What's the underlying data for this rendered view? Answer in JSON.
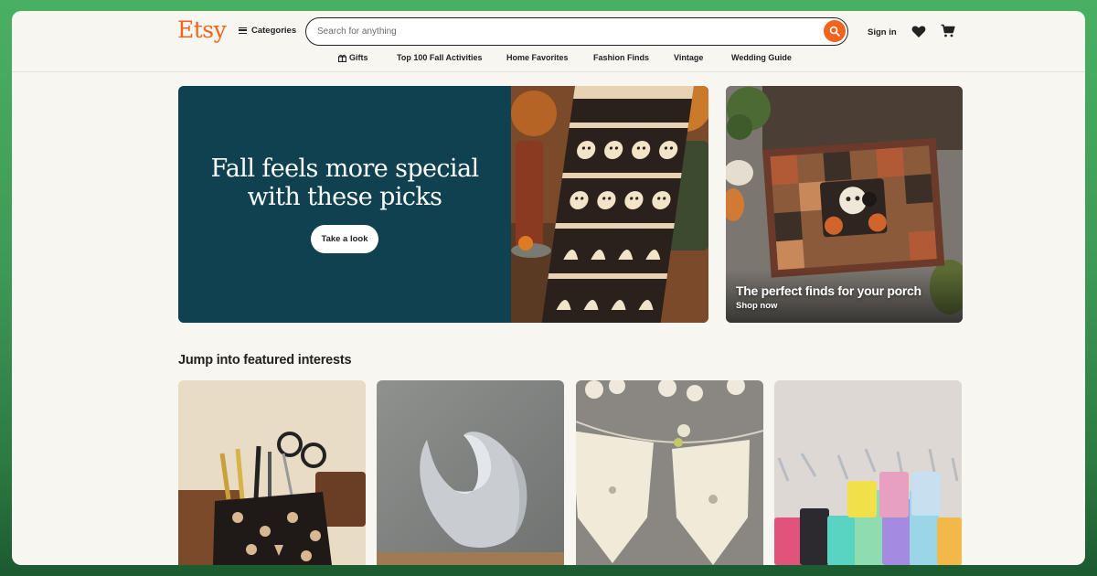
{
  "header": {
    "logo": "Etsy",
    "categories_label": "Categories",
    "search_placeholder": "Search for anything",
    "signin_label": "Sign in"
  },
  "nav": {
    "items": [
      "Gifts",
      "Top 100 Fall Activities",
      "Home Favorites",
      "Fashion Finds",
      "Vintage",
      "Wedding Guide"
    ]
  },
  "hero": {
    "title_line1": "Fall feels more special",
    "title_line2": "with these picks",
    "button_label": "Take a look",
    "bg_color": "#0f4150"
  },
  "promo": {
    "title": "The perfect finds for your porch",
    "link_label": "Shop now"
  },
  "featured": {
    "title": "Jump into featured interests"
  },
  "colors": {
    "brand": "#f1641e",
    "page_bg": "#f8f6f1",
    "text": "#222222"
  },
  "icons": [
    "hamburger-icon",
    "search-icon",
    "heart-icon",
    "cart-icon",
    "gift-icon"
  ]
}
